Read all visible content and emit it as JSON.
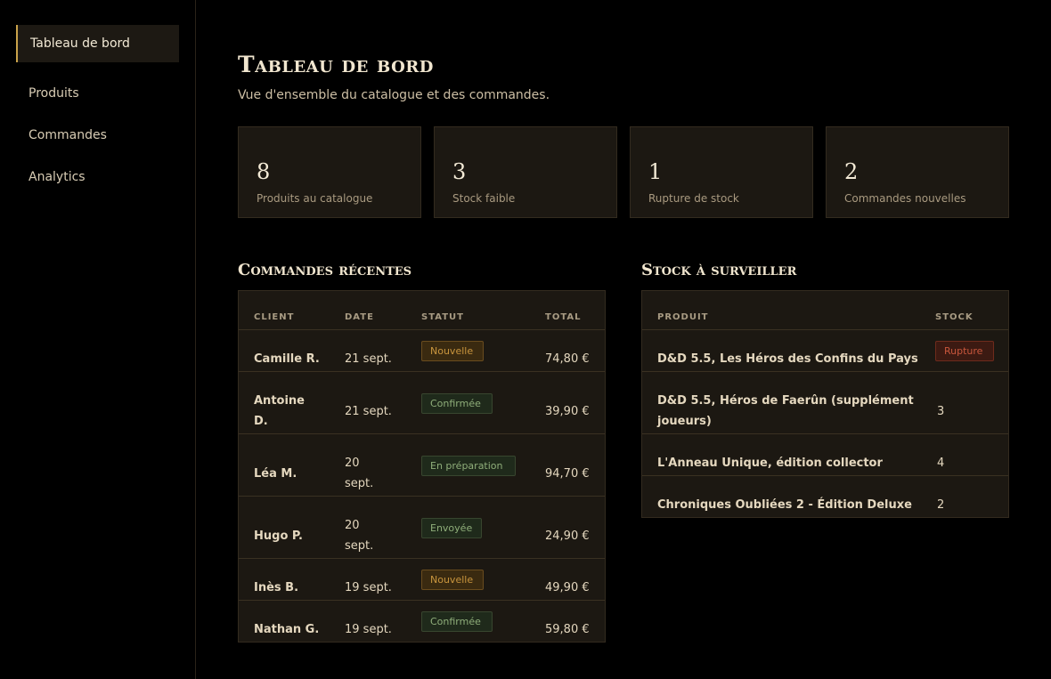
{
  "sidebar": {
    "items": [
      {
        "label": "Tableau de bord",
        "active": true
      },
      {
        "label": "Produits"
      },
      {
        "label": "Commandes"
      },
      {
        "label": "Analytics"
      }
    ]
  },
  "header": {
    "title": "Tableau de bord",
    "subtitle": "Vue d'ensemble du catalogue et des commandes."
  },
  "stats": [
    {
      "value": "8",
      "label": "Produits au catalogue"
    },
    {
      "value": "3",
      "label": "Stock faible"
    },
    {
      "value": "1",
      "label": "Rupture de stock"
    },
    {
      "value": "2",
      "label": "Commandes nouvelles"
    }
  ],
  "orders": {
    "title": "Commandes récentes",
    "columns": [
      "CLIENT",
      "DATE",
      "STATUT",
      "TOTAL"
    ],
    "rows": [
      {
        "client": "Camille R.",
        "date": "21 sept.",
        "status": "Nouvelle",
        "total": "74,80 €"
      },
      {
        "client": "Antoine D.",
        "date": "21 sept.",
        "status": "Confirmée",
        "total": "39,90 €"
      },
      {
        "client": "Léa M.",
        "date": "20 sept.",
        "status": "En préparation",
        "total": "94,70 €"
      },
      {
        "client": "Hugo P.",
        "date": "20 sept.",
        "status": "Envoyée",
        "total": "24,90 €"
      },
      {
        "client": "Inès B.",
        "date": "19 sept.",
        "status": "Nouvelle",
        "total": "49,90 €"
      },
      {
        "client": "Nathan G.",
        "date": "19 sept.",
        "status": "Confirmée",
        "total": "59,80 €"
      }
    ]
  },
  "stock": {
    "title": "Stock à surveiller",
    "columns": [
      "PRODUIT",
      "STOCK"
    ],
    "rows": [
      {
        "product": "D&D 5.5, Les Héros des Confins du Pays",
        "stock": "Rupture"
      },
      {
        "product": "D&D 5.5, Héros de Faerûn (supplément joueurs)",
        "stock": "3"
      },
      {
        "product": "L'Anneau Unique, édition collector",
        "stock": "4"
      },
      {
        "product": "Chroniques Oubliées 2 - Édition Deluxe",
        "stock": "2"
      }
    ]
  },
  "colors": {
    "accent": "#c9a24a",
    "badge_new": "#c9953e",
    "badge_ok": "#8fae7a",
    "badge_out": "#c8563c"
  }
}
